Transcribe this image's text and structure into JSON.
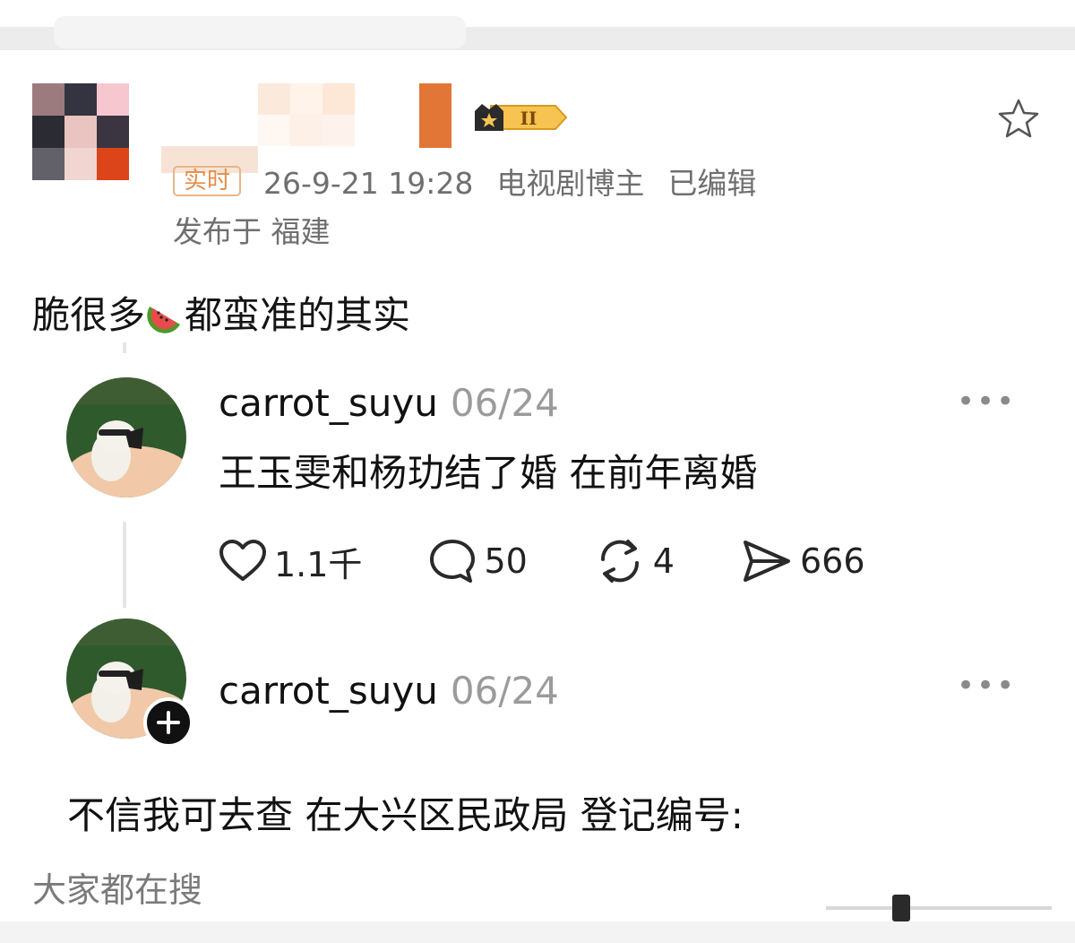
{
  "post": {
    "tag": "实时",
    "datetime": "26-9-21 19:28",
    "author_role": "电视剧博主",
    "edited": "已编辑",
    "location": "发布于 福建",
    "text_before_emoji": "脆很多",
    "text_after_emoji": "都蛮准的其实",
    "badge_level": "II"
  },
  "comments": [
    {
      "username": "carrot_suyu",
      "date": "06/24",
      "text": "王玉雯和杨玏结了婚 在前年离婚",
      "more": "•••",
      "actions": {
        "likes": "1.1千",
        "comments": "50",
        "reposts": "4",
        "shares": "666"
      }
    },
    {
      "username": "carrot_suyu",
      "date": "06/24",
      "more": "•••",
      "text": "不信我可去查 在大兴区民政局 登记编号:"
    }
  ],
  "footer": {
    "search_label": "大家都在搜"
  },
  "colors": {
    "tag": "#e48d4a",
    "muted": "#6f6f6f",
    "text": "#111111"
  },
  "icons": [
    "star-icon",
    "crown-badge-icon",
    "watermelon-icon",
    "heart-icon",
    "comment-icon",
    "repost-icon",
    "share-icon",
    "more-icon",
    "plus-icon"
  ]
}
